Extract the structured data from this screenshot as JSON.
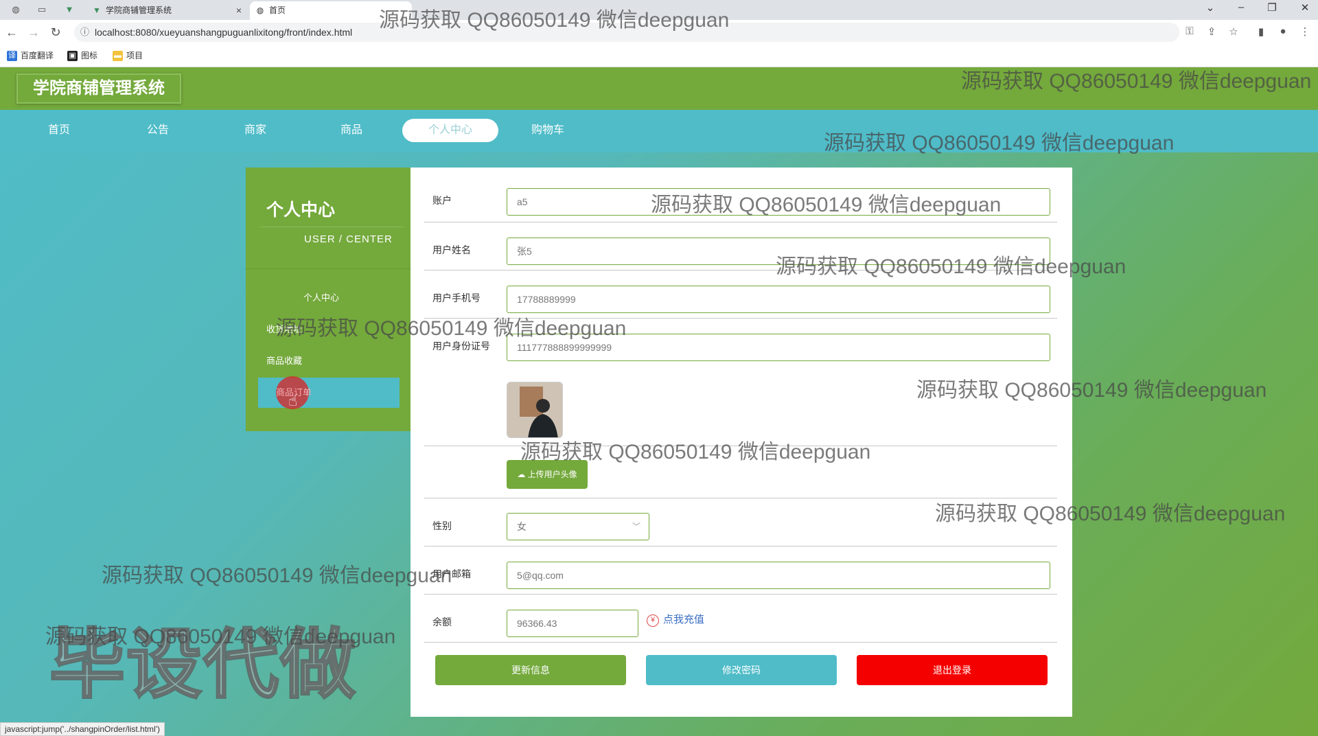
{
  "browser": {
    "tabs": [
      {
        "title": "学院商铺管理系统",
        "close": "×"
      },
      {
        "title": "首页"
      }
    ],
    "url": "localhost:8080/xueyuanshangpuguanlixitong/front/index.html",
    "bookmarks": [
      "百度翻译",
      "图标",
      "项目"
    ],
    "status_text": "javascript:jump('../shangpinOrder/list.html')"
  },
  "app": {
    "title": "学院商铺管理系统"
  },
  "nav": {
    "items": [
      "首页",
      "公告",
      "商家",
      "商品",
      "个人中心",
      "购物车"
    ],
    "active": "个人中心"
  },
  "sidebar": {
    "title": "个人中心",
    "subtitle": "USER / CENTER",
    "items": [
      "个人中心",
      "收货地址",
      "商品收藏",
      "商品订单"
    ],
    "active": "商品订单"
  },
  "form": {
    "account": {
      "label": "账户",
      "value": "a5"
    },
    "name": {
      "label": "用户姓名",
      "value": "张5"
    },
    "phone": {
      "label": "用户手机号",
      "value": "17788889999"
    },
    "id_card": {
      "label": "用户身份证号",
      "value": "111777888899999999"
    },
    "upload_label": "上传用户头像",
    "gender": {
      "label": "性别",
      "value": "女"
    },
    "email": {
      "label": "用户邮箱",
      "value": "5@qq.com"
    },
    "balance": {
      "label": "余额",
      "value": "96366.43"
    },
    "recharge_label": "点我充值",
    "buttons": {
      "update": "更新信息",
      "change_password": "修改密码",
      "logout": "退出登录"
    }
  },
  "watermark": {
    "text": "源码获取 QQ86050149 微信deepguan",
    "big_text": "毕设代做"
  },
  "colors": {
    "green": "#74a93c",
    "cyan": "#4fbcc8",
    "red": "#f50000"
  }
}
